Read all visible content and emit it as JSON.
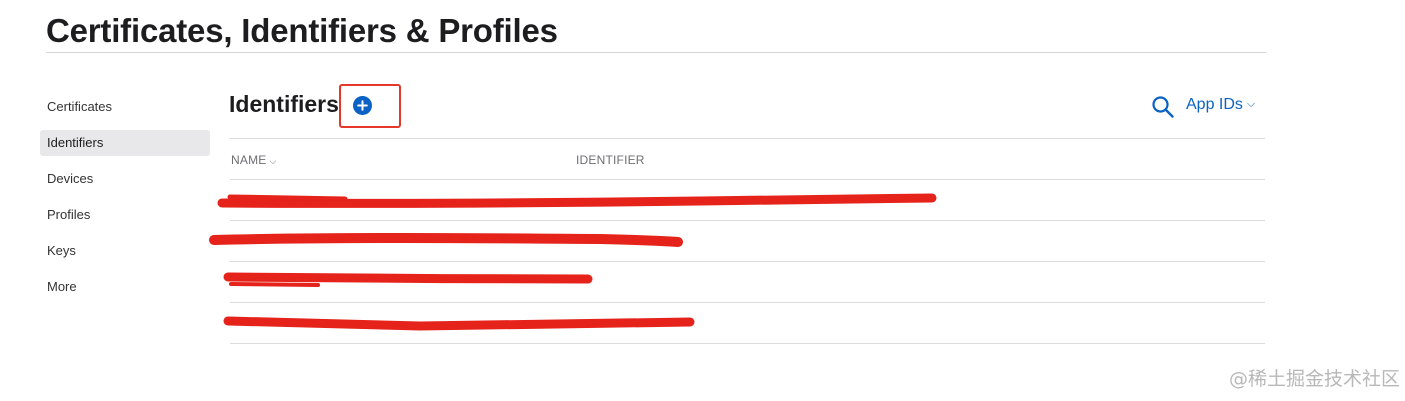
{
  "page": {
    "title": "Certificates, Identifiers & Profiles"
  },
  "sidebar": {
    "items": [
      {
        "label": "Certificates",
        "active": false
      },
      {
        "label": "Identifiers",
        "active": true
      },
      {
        "label": "Devices",
        "active": false
      },
      {
        "label": "Profiles",
        "active": false
      },
      {
        "label": "Keys",
        "active": false
      },
      {
        "label": "More",
        "active": false
      }
    ]
  },
  "main": {
    "section_title": "Identifiers",
    "add_icon": "plus-circle-icon",
    "search_icon": "search-icon",
    "filter_label": "App IDs",
    "filter_chevron": "⌵",
    "table": {
      "columns": [
        {
          "label": "NAME",
          "sortable": true,
          "sort_glyph": "⌵"
        },
        {
          "label": "IDENTIFIER",
          "sortable": false
        }
      ],
      "rows": [
        {
          "name": "",
          "identifier": ""
        },
        {
          "name": "",
          "identifier": ""
        },
        {
          "name": "",
          "identifier": ""
        },
        {
          "name": "",
          "identifier": ""
        }
      ]
    }
  },
  "colors": {
    "accent": "#0b62c4",
    "redaction": "#e5231b",
    "highlight": "#e5372c"
  },
  "watermark": "@稀土掘金技术社区"
}
